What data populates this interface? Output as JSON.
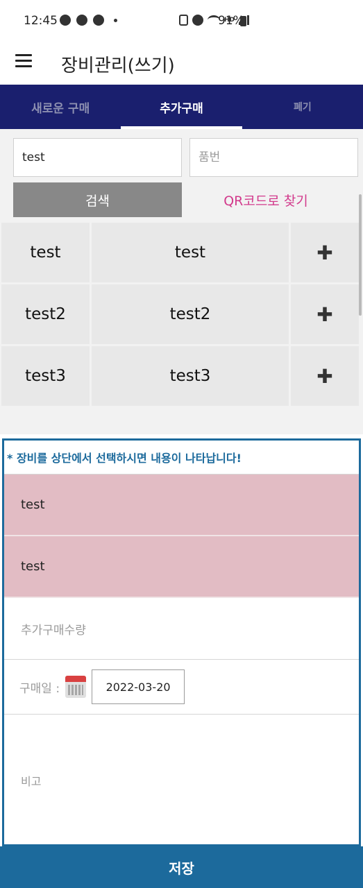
{
  "status_bar": {
    "time": "12:45",
    "battery": "91%",
    "icons": [
      "talk-icon",
      "person-icon",
      "timer-icon",
      "dot-icon",
      "battery-saver-icon",
      "alarm-icon",
      "wifi-icon",
      "hd-voice-icon",
      "signal-icon",
      "battery-icon"
    ],
    "hd_label": "HD"
  },
  "app_bar": {
    "title": "장비관리(쓰기)",
    "menu_icon": "menu-icon"
  },
  "tabs": [
    {
      "label": "새로운 구매",
      "active": false
    },
    {
      "label": "추가구매",
      "active": true
    },
    {
      "label": "폐기",
      "active": false
    }
  ],
  "search": {
    "name_value": "test",
    "number_placeholder": "품번",
    "search_button": "검색",
    "qr_link": "QR코드로 찾기"
  },
  "results": [
    {
      "col1": "test",
      "col2": "test",
      "action_icon": "plus-icon"
    },
    {
      "col1": "test2",
      "col2": "test2",
      "action_icon": "plus-icon"
    },
    {
      "col1": "test3",
      "col2": "test3",
      "action_icon": "plus-icon"
    }
  ],
  "detail": {
    "notice": "* 장비를 상단에서 선택하시면 내용이 나타납니다!",
    "field1": "test",
    "field2": "test",
    "quantity_placeholder": "추가구매수량",
    "date_label": "구매일 :",
    "date_value": "2022-03-20",
    "memo_placeholder": "비고"
  },
  "save_button": "저장",
  "colors": {
    "tab_bar": "#1a1f6e",
    "accent_blue": "#1c6a9c",
    "qr_pink": "#d23a8c",
    "selected_pink": "#e2bcc4",
    "search_button": "#888888"
  }
}
